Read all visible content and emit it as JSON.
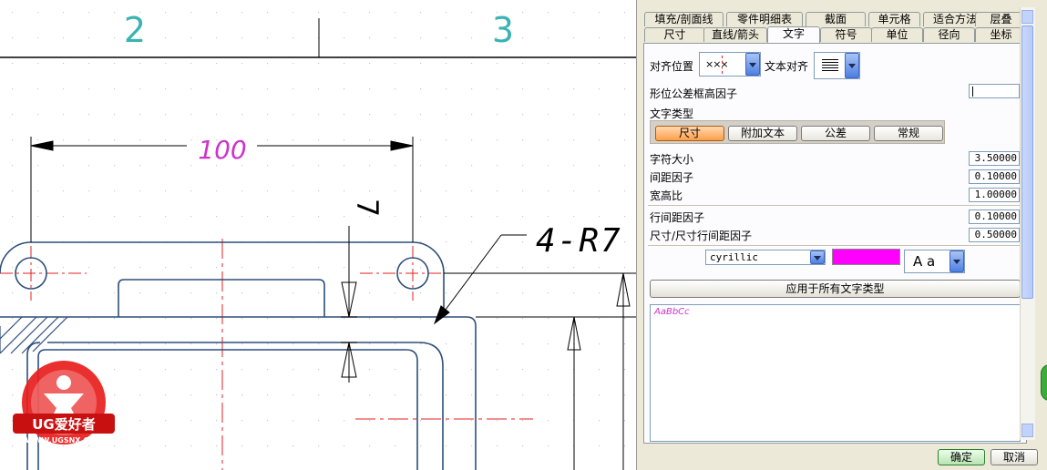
{
  "drawing": {
    "column_numbers": [
      "2",
      "3"
    ],
    "dim_100": "100",
    "dim_7": "7",
    "callout_radius": "4-R7",
    "logo": {
      "brand": "UG爱好者",
      "url": "WWW.UGSNX.COM"
    }
  },
  "dialog": {
    "tabs_row1": [
      "填充/剖面线",
      "零件明细表",
      "截面",
      "单元格",
      "适合方法",
      "层叠"
    ],
    "tabs_row2": [
      "尺寸",
      "直线/箭头",
      "文字",
      "符号",
      "单位",
      "径向",
      "坐标"
    ],
    "active_tab": "文字",
    "align_label": "对齐位置",
    "align_glyph": "×××",
    "text_align_label": "文本对齐",
    "gdt_factor_label": "形位公差框高因子",
    "gdt_factor_value": "",
    "text_type_label": "文字类型",
    "text_types": [
      "尺寸",
      "附加文本",
      "公差",
      "常规"
    ],
    "selected_text_type": "尺寸",
    "fields": [
      {
        "label": "字符大小",
        "value": "3.50000"
      },
      {
        "label": "间距因子",
        "value": "0.10000"
      },
      {
        "label": "宽高比",
        "value": "1.00000"
      },
      {
        "label": "行间距因子",
        "value": "0.10000"
      },
      {
        "label": "尺寸/尺寸行间距因子",
        "value": "0.50000"
      }
    ],
    "font_value": "cyrillic",
    "color": "#ff00ff",
    "font_style_value": "A a",
    "apply_all_label": "应用于所有文字类型",
    "preview_text": "AaBbCc",
    "ok_label": "确定",
    "cancel_label": "取消"
  },
  "colors": {
    "part_lines": "#2d4e7a",
    "center_lines": "#e02020",
    "dim_100_text": "#cc33cc",
    "column_numbers": "#39b3b3",
    "accent_orange": "#ff9f4a"
  }
}
